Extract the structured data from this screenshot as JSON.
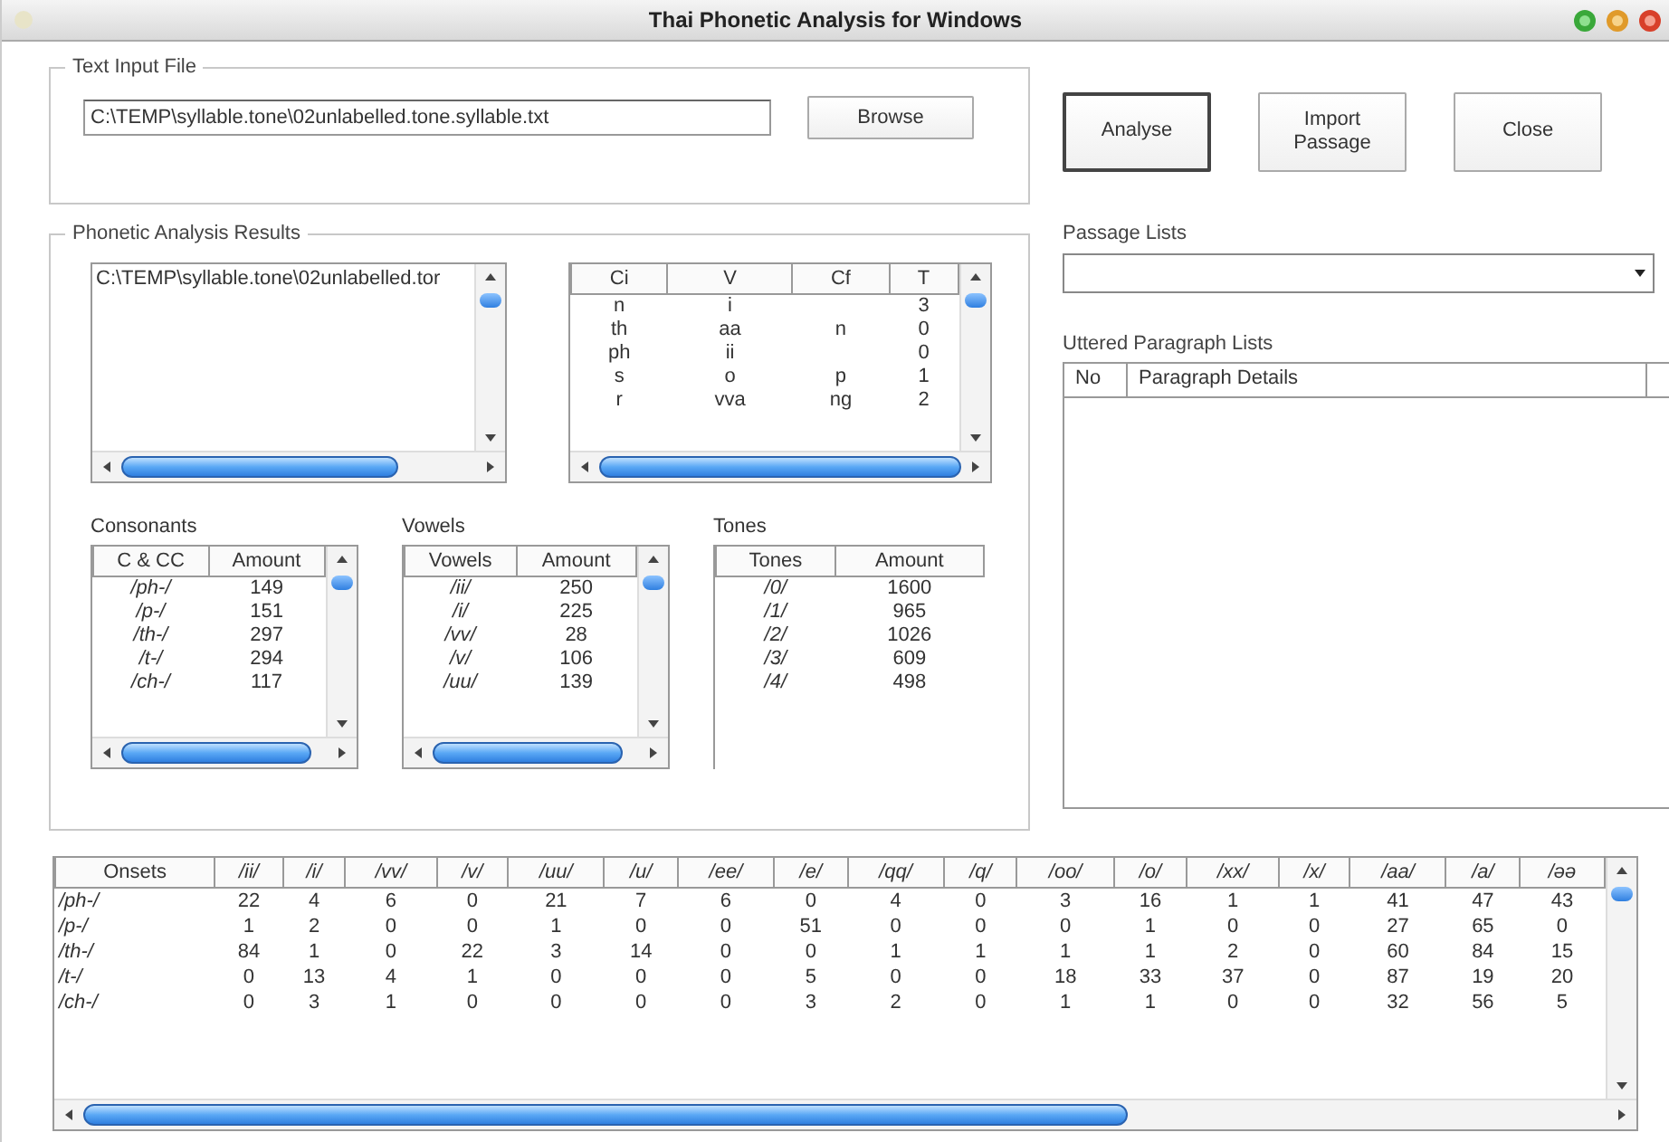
{
  "window": {
    "title": "Thai Phonetic Analysis for Windows"
  },
  "text_input_file": {
    "legend": "Text Input File",
    "path": "C:\\TEMP\\syllable.tone\\02unlabelled.tone.syllable.txt",
    "browse_button": "Browse"
  },
  "buttons": [
    {
      "label": "Analyse",
      "default": true
    },
    {
      "label": "Import Passage",
      "default": false
    },
    {
      "label": "Close",
      "default": false
    }
  ],
  "results": {
    "legend": "Phonetic Analysis Results",
    "files": [
      "C:\\TEMP\\syllable.tone\\02unlabelled.tor"
    ],
    "syllables": {
      "columns": [
        "Ci",
        "V",
        "Cf",
        "T"
      ],
      "rows": [
        [
          "n",
          "i",
          null,
          "3"
        ],
        [
          "th",
          "aa",
          "n",
          "0"
        ],
        [
          "ph",
          "ii",
          null,
          "0"
        ],
        [
          "s",
          "o",
          "p",
          "1"
        ],
        [
          "r",
          "vva",
          "ng",
          "2"
        ]
      ]
    },
    "consonants": {
      "title": "Consonants",
      "columns": [
        "C & CC",
        "Amount"
      ],
      "rows": [
        [
          "/ph-/",
          "149"
        ],
        [
          "/p-/",
          "151"
        ],
        [
          "/th-/",
          "297"
        ],
        [
          "/t-/",
          "294"
        ],
        [
          "/ch-/",
          "117"
        ]
      ]
    },
    "vowels": {
      "title": "Vowels",
      "columns": [
        "Vowels",
        "Amount"
      ],
      "rows": [
        [
          "/ii/",
          "250"
        ],
        [
          "/i/",
          "225"
        ],
        [
          "/vv/",
          "28"
        ],
        [
          "/v/",
          "106"
        ],
        [
          "/uu/",
          "139"
        ]
      ]
    },
    "tones": {
      "title": "Tones",
      "columns": [
        "Tones",
        "Amount"
      ],
      "rows": [
        [
          "/0/",
          "1600"
        ],
        [
          "/1/",
          "965"
        ],
        [
          "/2/",
          "1026"
        ],
        [
          "/3/",
          "609"
        ],
        [
          "/4/",
          "498"
        ]
      ]
    }
  },
  "passage_lists": {
    "label": "Passage Lists"
  },
  "uttered_paragraph_lists": {
    "label": "Uttered Paragraph Lists",
    "columns": [
      "No",
      "Paragraph Details"
    ]
  },
  "onset_table": {
    "columns": [
      "Onsets",
      "/ii/",
      "/i/",
      "/vv/",
      "/v/",
      "/uu/",
      "/u/",
      "/ee/",
      "/e/",
      "/qq/",
      "/q/",
      "/oo/",
      "/o/",
      "/xx/",
      "/x/",
      "/aa/",
      "/a/",
      "/əə"
    ],
    "rows": [
      [
        "/ph-/",
        "22",
        "4",
        "6",
        "0",
        "21",
        "7",
        "6",
        "0",
        "4",
        "0",
        "3",
        "16",
        "1",
        "1",
        "41",
        "47",
        "43"
      ],
      [
        "/p-/",
        "1",
        "2",
        "0",
        "0",
        "1",
        "0",
        "0",
        "51",
        "0",
        "0",
        "0",
        "1",
        "0",
        "0",
        "27",
        "65",
        "0"
      ],
      [
        "/th-/",
        "84",
        "1",
        "0",
        "22",
        "3",
        "14",
        "0",
        "0",
        "1",
        "1",
        "1",
        "1",
        "2",
        "0",
        "60",
        "84",
        "15"
      ],
      [
        "/t-/",
        "0",
        "13",
        "4",
        "1",
        "0",
        "0",
        "0",
        "5",
        "0",
        "0",
        "18",
        "33",
        "37",
        "0",
        "87",
        "19",
        "20"
      ],
      [
        "/ch-/",
        "0",
        "3",
        "1",
        "0",
        "0",
        "0",
        "0",
        "3",
        "2",
        "0",
        "1",
        "1",
        "0",
        "0",
        "32",
        "56",
        "5"
      ]
    ]
  }
}
